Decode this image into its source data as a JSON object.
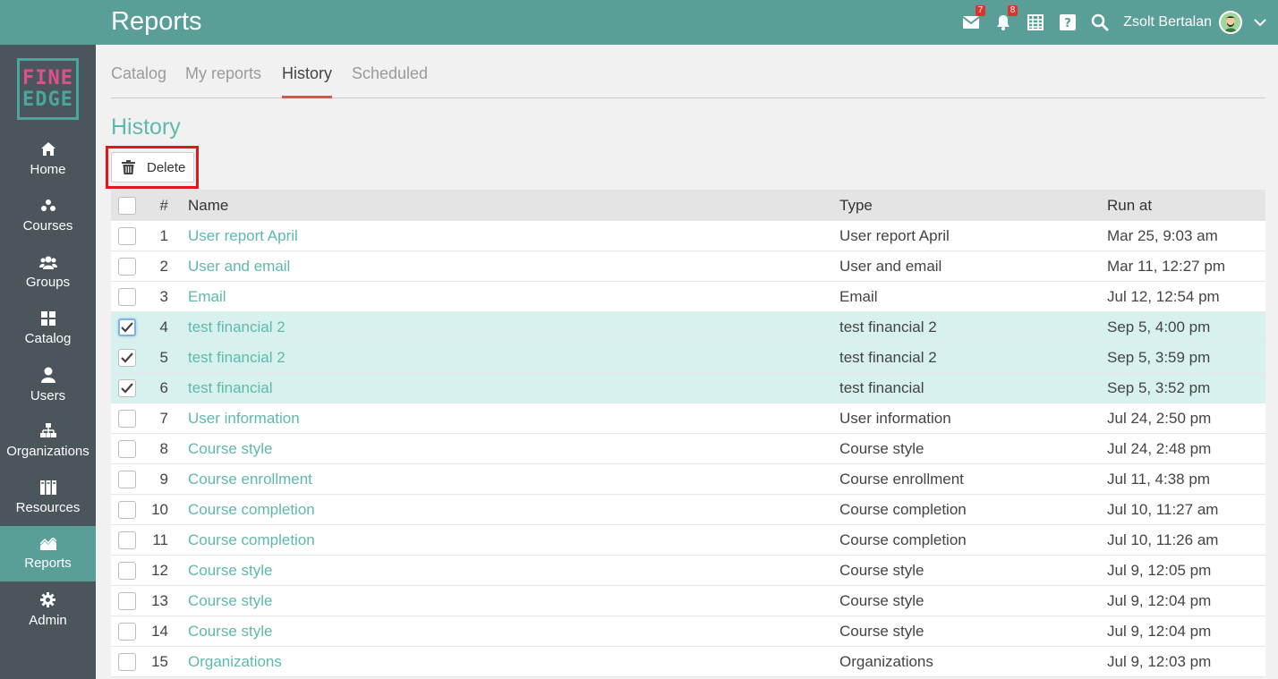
{
  "header": {
    "title": "Reports",
    "user_name": "Zsolt Bertalan",
    "messages_badge": "7",
    "notifications_badge": "8"
  },
  "logo": {
    "line1": "FINE",
    "line2": "EDGE"
  },
  "sidebar": {
    "items": [
      {
        "label": "Home",
        "icon": "home-icon"
      },
      {
        "label": "Courses",
        "icon": "courses-icon"
      },
      {
        "label": "Groups",
        "icon": "groups-icon"
      },
      {
        "label": "Catalog",
        "icon": "catalog-icon"
      },
      {
        "label": "Users",
        "icon": "users-icon"
      },
      {
        "label": "Organizations",
        "icon": "organizations-icon"
      },
      {
        "label": "Resources",
        "icon": "resources-icon"
      },
      {
        "label": "Reports",
        "icon": "reports-icon",
        "active": true
      },
      {
        "label": "Admin",
        "icon": "gear-icon"
      }
    ]
  },
  "tabs": [
    {
      "label": "Catalog"
    },
    {
      "label": "My reports"
    },
    {
      "label": "History",
      "active": true
    },
    {
      "label": "Scheduled"
    }
  ],
  "page_title": "History",
  "toolbar": {
    "delete_label": "Delete"
  },
  "table": {
    "headers": {
      "num": "#",
      "name": "Name",
      "type": "Type",
      "run_at": "Run at"
    },
    "rows": [
      {
        "num": "1",
        "name": "User report April",
        "type": "User report April",
        "run_at": "Mar 25, 9:03 am",
        "checked": false
      },
      {
        "num": "2",
        "name": "User and email",
        "type": "User and email",
        "run_at": "Mar 11, 12:27 pm",
        "checked": false
      },
      {
        "num": "3",
        "name": "Email",
        "type": "Email",
        "run_at": "Jul 12, 12:54 pm",
        "checked": false
      },
      {
        "num": "4",
        "name": "test financial 2",
        "type": "test financial 2",
        "run_at": "Sep 5, 4:00 pm",
        "checked": true
      },
      {
        "num": "5",
        "name": "test financial 2",
        "type": "test financial 2",
        "run_at": "Sep 5, 3:59 pm",
        "checked": true
      },
      {
        "num": "6",
        "name": "test financial",
        "type": "test financial",
        "run_at": "Sep 5, 3:52 pm",
        "checked": true
      },
      {
        "num": "7",
        "name": "User information",
        "type": "User information",
        "run_at": "Jul 24, 2:50 pm",
        "checked": false
      },
      {
        "num": "8",
        "name": "Course style",
        "type": "Course style",
        "run_at": "Jul 24, 2:48 pm",
        "checked": false
      },
      {
        "num": "9",
        "name": "Course enrollment",
        "type": "Course enrollment",
        "run_at": "Jul 11, 4:38 pm",
        "checked": false
      },
      {
        "num": "10",
        "name": "Course completion",
        "type": "Course completion",
        "run_at": "Jul 10, 11:27 am",
        "checked": false
      },
      {
        "num": "11",
        "name": "Course completion",
        "type": "Course completion",
        "run_at": "Jul 10, 11:26 am",
        "checked": false
      },
      {
        "num": "12",
        "name": "Course style",
        "type": "Course style",
        "run_at": "Jul 9, 12:05 pm",
        "checked": false
      },
      {
        "num": "13",
        "name": "Course style",
        "type": "Course style",
        "run_at": "Jul 9, 12:04 pm",
        "checked": false
      },
      {
        "num": "14",
        "name": "Course style",
        "type": "Course style",
        "run_at": "Jul 9, 12:04 pm",
        "checked": false
      },
      {
        "num": "15",
        "name": "Organizations",
        "type": "Organizations",
        "run_at": "Jul 9, 12:03 pm",
        "checked": false
      }
    ]
  },
  "colors": {
    "topbar": "#5a9e98",
    "sidebar": "#4a555c",
    "accent": "#5fb8ae",
    "selected_row": "#d7f1ee",
    "badge": "#d9352f",
    "highlight": "#e8141b"
  }
}
